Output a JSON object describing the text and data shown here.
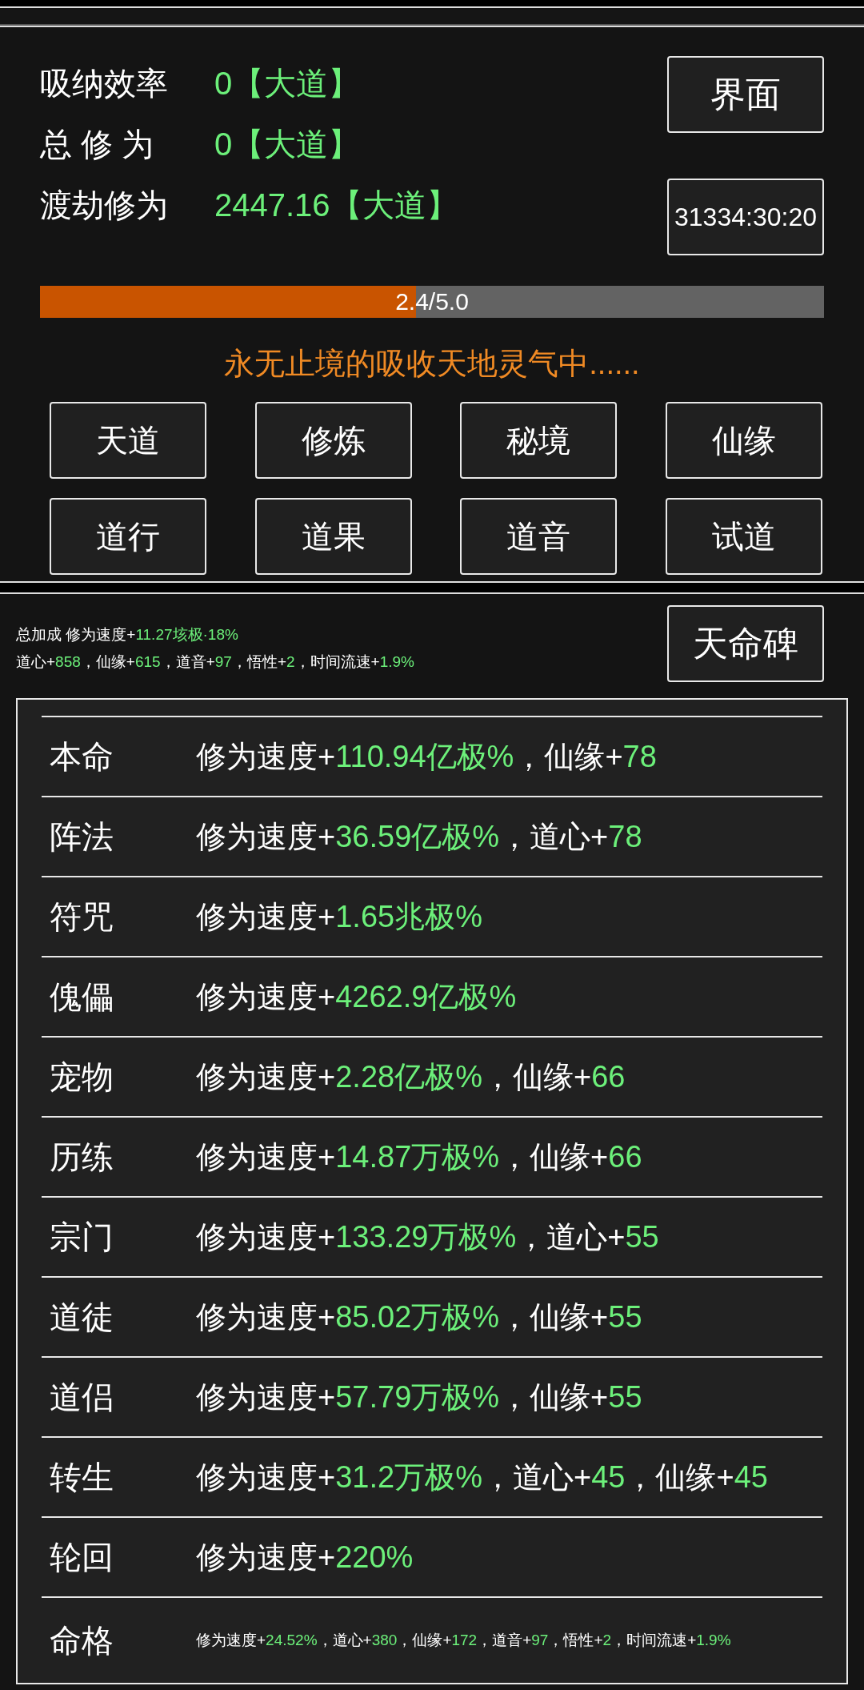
{
  "stats": [
    {
      "label": "吸纳效率",
      "value": "0【大道】"
    },
    {
      "label": "总 修 为",
      "value": "0【大道】"
    },
    {
      "label": "渡劫修为",
      "value": "2447.16【大道】"
    }
  ],
  "interface_button": "界面",
  "timer": "31334:30:20",
  "progress": {
    "level": 0.48,
    "reading": "2.4/5.0"
  },
  "status": "永无止境的吸收天地灵气中......",
  "nav_buttons": [
    "天道",
    "修炼",
    "秘境",
    "仙缘",
    "道行",
    "道果",
    "道音",
    "试道"
  ],
  "bonus_lines": [
    [
      {
        "text": "总加成 修为速度+",
        "kind": "plain"
      },
      {
        "text": "11.27垓极·18%",
        "kind": "value"
      }
    ],
    [
      {
        "text": "道心+",
        "kind": "plain"
      },
      {
        "text": "858",
        "kind": "value"
      },
      {
        "text": "，仙缘+",
        "kind": "plain"
      },
      {
        "text": "615",
        "kind": "value"
      },
      {
        "text": "，道音+",
        "kind": "plain"
      },
      {
        "text": "97",
        "kind": "value"
      },
      {
        "text": "，悟性+",
        "kind": "plain"
      },
      {
        "text": "2",
        "kind": "value"
      },
      {
        "text": "，时间流速+",
        "kind": "plain"
      },
      {
        "text": "1.9%",
        "kind": "value"
      }
    ]
  ],
  "stele_button": "天命碑",
  "rows": [
    {
      "name": "本命",
      "kind": "full",
      "parts": [
        {
          "text": "修为速度+",
          "kind": "plain"
        },
        {
          "text": "110.94亿极%",
          "kind": "value"
        },
        {
          "text": "，仙缘+",
          "kind": "plain"
        },
        {
          "text": "78",
          "kind": "value"
        }
      ]
    },
    {
      "name": "阵法",
      "kind": "full",
      "parts": [
        {
          "text": "修为速度+",
          "kind": "plain"
        },
        {
          "text": "36.59亿极%",
          "kind": "value"
        },
        {
          "text": "，道心+",
          "kind": "plain"
        },
        {
          "text": "78",
          "kind": "value"
        }
      ]
    },
    {
      "name": "符咒",
      "kind": "full",
      "parts": [
        {
          "text": "修为速度+",
          "kind": "plain"
        },
        {
          "text": "1.65兆极%",
          "kind": "value"
        }
      ]
    },
    {
      "name": "傀儡",
      "kind": "full",
      "parts": [
        {
          "text": "修为速度+",
          "kind": "plain"
        },
        {
          "text": "4262.9亿极%",
          "kind": "value"
        }
      ]
    },
    {
      "name": "宠物",
      "kind": "full",
      "parts": [
        {
          "text": "修为速度+",
          "kind": "plain"
        },
        {
          "text": "2.28亿极%",
          "kind": "value"
        },
        {
          "text": "，仙缘+",
          "kind": "plain"
        },
        {
          "text": "66",
          "kind": "value"
        }
      ]
    },
    {
      "name": "历练",
      "kind": "full",
      "parts": [
        {
          "text": "修为速度+",
          "kind": "plain"
        },
        {
          "text": "14.87万极%",
          "kind": "value"
        },
        {
          "text": "，仙缘+",
          "kind": "plain"
        },
        {
          "text": "66",
          "kind": "value"
        }
      ]
    },
    {
      "name": "宗门",
      "kind": "full",
      "parts": [
        {
          "text": "修为速度+",
          "kind": "plain"
        },
        {
          "text": "133.29万极%",
          "kind": "value"
        },
        {
          "text": "，道心+",
          "kind": "plain"
        },
        {
          "text": "55",
          "kind": "value"
        }
      ]
    },
    {
      "name": "道徒",
      "kind": "full",
      "parts": [
        {
          "text": "修为速度+",
          "kind": "plain"
        },
        {
          "text": "85.02万极%",
          "kind": "value"
        },
        {
          "text": "，仙缘+",
          "kind": "plain"
        },
        {
          "text": "55",
          "kind": "value"
        }
      ]
    },
    {
      "name": "道侣",
      "kind": "full",
      "parts": [
        {
          "text": "修为速度+",
          "kind": "plain"
        },
        {
          "text": "57.79万极%",
          "kind": "value"
        },
        {
          "text": "，仙缘+",
          "kind": "plain"
        },
        {
          "text": "55",
          "kind": "value"
        }
      ]
    },
    {
      "name": "转生",
      "kind": "full",
      "parts": [
        {
          "text": "修为速度+",
          "kind": "plain"
        },
        {
          "text": "31.2万极%",
          "kind": "value"
        },
        {
          "text": "，道心+",
          "kind": "plain"
        },
        {
          "text": "45",
          "kind": "value"
        },
        {
          "text": "，仙缘+",
          "kind": "plain"
        },
        {
          "text": "45",
          "kind": "value"
        }
      ]
    },
    {
      "name": "轮回",
      "kind": "full",
      "parts": [
        {
          "text": "修为速度+",
          "kind": "plain"
        },
        {
          "text": "220%",
          "kind": "value"
        }
      ]
    },
    {
      "name": "命格",
      "kind": "compact",
      "parts": [
        {
          "text": "修为速度+",
          "kind": "plain"
        },
        {
          "text": "24.52%",
          "kind": "value"
        },
        {
          "text": "，道心+",
          "kind": "plain"
        },
        {
          "text": "380",
          "kind": "value"
        },
        {
          "text": "，仙缘+",
          "kind": "plain"
        },
        {
          "text": "172",
          "kind": "value"
        },
        {
          "text": "，道音+",
          "kind": "plain"
        },
        {
          "text": "97",
          "kind": "value"
        },
        {
          "text": "，悟性+",
          "kind": "plain"
        },
        {
          "text": "2",
          "kind": "value"
        },
        {
          "text": "，时间流速+",
          "kind": "plain"
        },
        {
          "text": "1.9%",
          "kind": "value"
        }
      ]
    }
  ]
}
